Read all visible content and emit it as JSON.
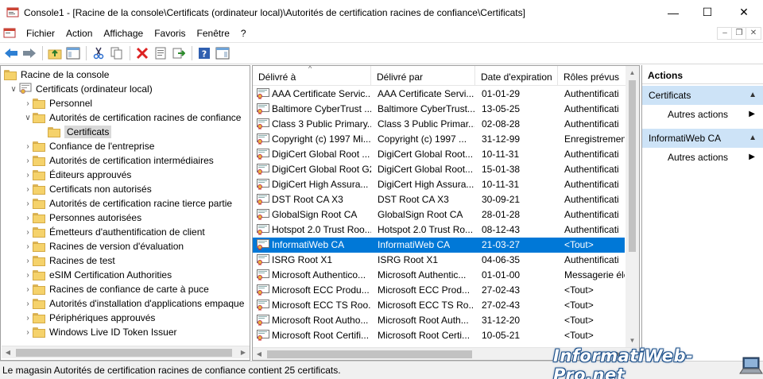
{
  "window": {
    "title": "Console1 - [Racine de la console\\Certificats (ordinateur local)\\Autorités de certification racines de confiance\\Certificats]",
    "minimize_glyph": "—",
    "maximize_glyph": "☐",
    "close_glyph": "✕"
  },
  "menubar": {
    "items": [
      "Fichier",
      "Action",
      "Affichage",
      "Favoris",
      "Fenêtre",
      "?"
    ],
    "mdi_minimize": "–",
    "mdi_restore": "❐",
    "mdi_close": "✕"
  },
  "toolbar": {
    "buttons": [
      "back-icon",
      "forward-icon",
      "up-folder-icon",
      "show-hide-tree-icon",
      "cut-icon",
      "copy-icon",
      "delete-icon",
      "properties-icon",
      "export-icon",
      "help-icon",
      "show-hide-action-pane-icon"
    ]
  },
  "tree": {
    "items": [
      {
        "label": "Racine de la console",
        "level": 0,
        "expander": ""
      },
      {
        "label": "Certificats (ordinateur local)",
        "level": 1,
        "expander": "∨"
      },
      {
        "label": "Personnel",
        "level": 2,
        "expander": "›"
      },
      {
        "label": "Autorités de certification racines de confiance",
        "level": 2,
        "expander": "∨"
      },
      {
        "label": "Certificats",
        "level": 3,
        "expander": "",
        "selected": true
      },
      {
        "label": "Confiance de l'entreprise",
        "level": 2,
        "expander": "›"
      },
      {
        "label": "Autorités de certification intermédiaires",
        "level": 2,
        "expander": "›"
      },
      {
        "label": "Éditeurs approuvés",
        "level": 2,
        "expander": "›"
      },
      {
        "label": "Certificats non autorisés",
        "level": 2,
        "expander": "›"
      },
      {
        "label": "Autorités de certification racine tierce partie",
        "level": 2,
        "expander": "›"
      },
      {
        "label": "Personnes autorisées",
        "level": 2,
        "expander": "›"
      },
      {
        "label": "Émetteurs d'authentification de client",
        "level": 2,
        "expander": "›"
      },
      {
        "label": "Racines de version d'évaluation",
        "level": 2,
        "expander": "›"
      },
      {
        "label": "Racines de test",
        "level": 2,
        "expander": "›"
      },
      {
        "label": "eSIM Certification Authorities",
        "level": 2,
        "expander": "›"
      },
      {
        "label": "Racines de confiance de carte à puce",
        "level": 2,
        "expander": "›"
      },
      {
        "label": "Autorités d'installation d'applications empaque",
        "level": 2,
        "expander": "›"
      },
      {
        "label": "Périphériques approuvés",
        "level": 2,
        "expander": "›"
      },
      {
        "label": "Windows Live ID Token Issuer",
        "level": 2,
        "expander": "›"
      }
    ]
  },
  "list": {
    "columns": [
      "Délivré à",
      "Délivré par",
      "Date d'expiration",
      "Rôles prévus"
    ],
    "sort_glyph": "^",
    "rows": [
      {
        "issued_to": "AAA Certificate Servic...",
        "issued_by": "AAA Certificate Servi...",
        "expires": "01-01-29",
        "roles": "Authentificati"
      },
      {
        "issued_to": "Baltimore CyberTrust ...",
        "issued_by": "Baltimore CyberTrust...",
        "expires": "13-05-25",
        "roles": "Authentificati"
      },
      {
        "issued_to": "Class 3 Public Primary...",
        "issued_by": "Class 3 Public Primar...",
        "expires": "02-08-28",
        "roles": "Authentificati"
      },
      {
        "issued_to": "Copyright (c) 1997 Mi...",
        "issued_by": "Copyright (c) 1997 ...",
        "expires": "31-12-99",
        "roles": "Enregistremen"
      },
      {
        "issued_to": "DigiCert Global Root ...",
        "issued_by": "DigiCert Global Root...",
        "expires": "10-11-31",
        "roles": "Authentificati"
      },
      {
        "issued_to": "DigiCert Global Root G2",
        "issued_by": "DigiCert Global Root...",
        "expires": "15-01-38",
        "roles": "Authentificati"
      },
      {
        "issued_to": "DigiCert High Assura...",
        "issued_by": "DigiCert High Assura...",
        "expires": "10-11-31",
        "roles": "Authentificati"
      },
      {
        "issued_to": "DST Root CA X3",
        "issued_by": "DST Root CA X3",
        "expires": "30-09-21",
        "roles": "Authentificati"
      },
      {
        "issued_to": "GlobalSign Root CA",
        "issued_by": "GlobalSign Root CA",
        "expires": "28-01-28",
        "roles": "Authentificati"
      },
      {
        "issued_to": "Hotspot 2.0 Trust Roo...",
        "issued_by": "Hotspot 2.0 Trust Ro...",
        "expires": "08-12-43",
        "roles": "Authentificati"
      },
      {
        "issued_to": "InformatiWeb CA",
        "issued_by": "InformatiWeb CA",
        "expires": "21-03-27",
        "roles": "<Tout>",
        "selected": true
      },
      {
        "issued_to": "ISRG Root X1",
        "issued_by": "ISRG Root X1",
        "expires": "04-06-35",
        "roles": "Authentificati"
      },
      {
        "issued_to": "Microsoft Authentico...",
        "issued_by": "Microsoft Authentic...",
        "expires": "01-01-00",
        "roles": "Messagerie éle"
      },
      {
        "issued_to": "Microsoft ECC Produ...",
        "issued_by": "Microsoft ECC Prod...",
        "expires": "27-02-43",
        "roles": "<Tout>"
      },
      {
        "issued_to": "Microsoft ECC TS Roo...",
        "issued_by": "Microsoft ECC TS Ro...",
        "expires": "27-02-43",
        "roles": "<Tout>"
      },
      {
        "issued_to": "Microsoft Root Autho...",
        "issued_by": "Microsoft Root Auth...",
        "expires": "31-12-20",
        "roles": "<Tout>"
      },
      {
        "issued_to": "Microsoft Root Certifi...",
        "issued_by": "Microsoft Root Certi...",
        "expires": "10-05-21",
        "roles": "<Tout>"
      }
    ]
  },
  "actions": {
    "title": "Actions",
    "sections": [
      {
        "header": "Certificats",
        "items": [
          "Autres actions"
        ]
      },
      {
        "header": "InformatiWeb CA",
        "items": [
          "Autres actions"
        ]
      }
    ],
    "collapse_glyph": "▲",
    "more_glyph": "▶"
  },
  "status": {
    "text": "Le magasin Autorités de certification racines de confiance contient 25 certificats."
  },
  "watermark": {
    "text": "InformatiWeb-Pro.net"
  },
  "colors": {
    "selection": "#0078d7",
    "actions_section": "#cde3f7",
    "folder": "#f5d26b"
  }
}
